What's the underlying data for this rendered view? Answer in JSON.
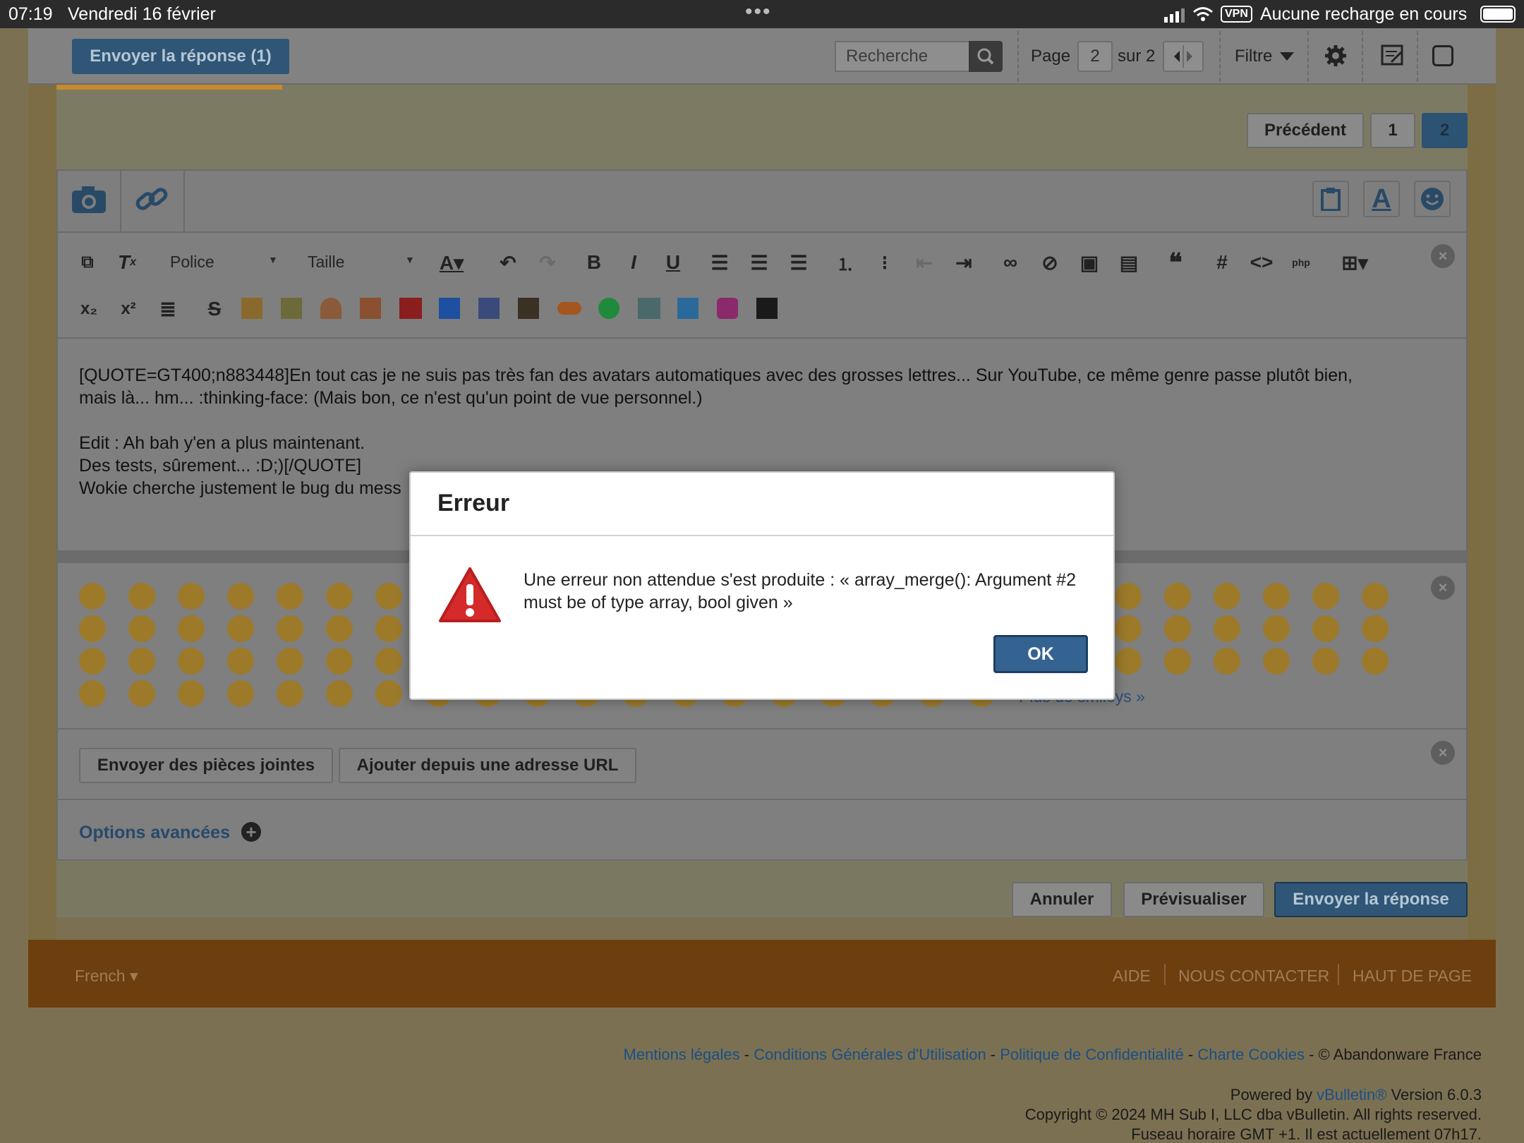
{
  "status_bar": {
    "time": "07:19",
    "date": "Vendredi 16 février",
    "dots": "•••",
    "vpn": "VPN",
    "battery_text": "Aucune recharge en cours"
  },
  "toolbar": {
    "send_reply_count": "Envoyer la réponse (1)",
    "search_placeholder": "Recherche",
    "page_label": "Page",
    "page_value": "2",
    "page_of": "sur 2",
    "filter": "Filtre"
  },
  "pagination": {
    "previous": "Précédent",
    "pages": [
      "1",
      "2"
    ],
    "current": "2"
  },
  "editor": {
    "font_select": "Police",
    "size_select": "Taille",
    "text_lines": [
      "[QUOTE=GT400;n883448]En tout cas je ne suis pas très fan des avatars automatiques avec des grosses lettres... Sur YouTube, ce même genre passe plutôt bien,",
      "mais là... hm... :thinking-face: (Mais bon, ce n'est qu'un point de vue personnel.)",
      "",
      "Edit : Ah bah y'en a plus maintenant.",
      "Des tests, sûrement... :D;)[/QUOTE]",
      "Wokie cherche justement le bug du mess"
    ],
    "more_smileys": "Plus de smileys »"
  },
  "attachments": {
    "upload": "Envoyer des pièces jointes",
    "from_url": "Ajouter depuis une adresse URL"
  },
  "advanced_options": "Options avancées",
  "actions": {
    "cancel": "Annuler",
    "preview": "Prévisualiser",
    "send": "Envoyer la réponse"
  },
  "footer": {
    "language": "French ▾",
    "help": "AIDE",
    "contact": "NOUS CONTACTER",
    "top": "HAUT DE PAGE"
  },
  "legal": {
    "mentions": "Mentions légales",
    "cgu": "Conditions Générales d'Utilisation",
    "privacy": "Politique de Confidentialité",
    "cookies": "Charte Cookies",
    "copyright_site": "- © Abandonware France",
    "sep": " - ",
    "powered_prefix": "Powered by ",
    "vb": "vBulletin®",
    "version": " Version 6.0.3",
    "copyright": "Copyright © 2024 MH Sub I, LLC dba vBulletin. All rights reserved.",
    "timezone": "Fuseau horaire GMT +1. Il est actuellement 07h17."
  },
  "modal": {
    "title": "Erreur",
    "message": "Une erreur non attendue s'est produite : « array_merge(): Argument #2 must be of type array, bool given »",
    "ok": "OK"
  },
  "colors": {
    "accent": "#346391",
    "error_red": "#d42a2a",
    "footer_bar": "#6d3f0e"
  }
}
